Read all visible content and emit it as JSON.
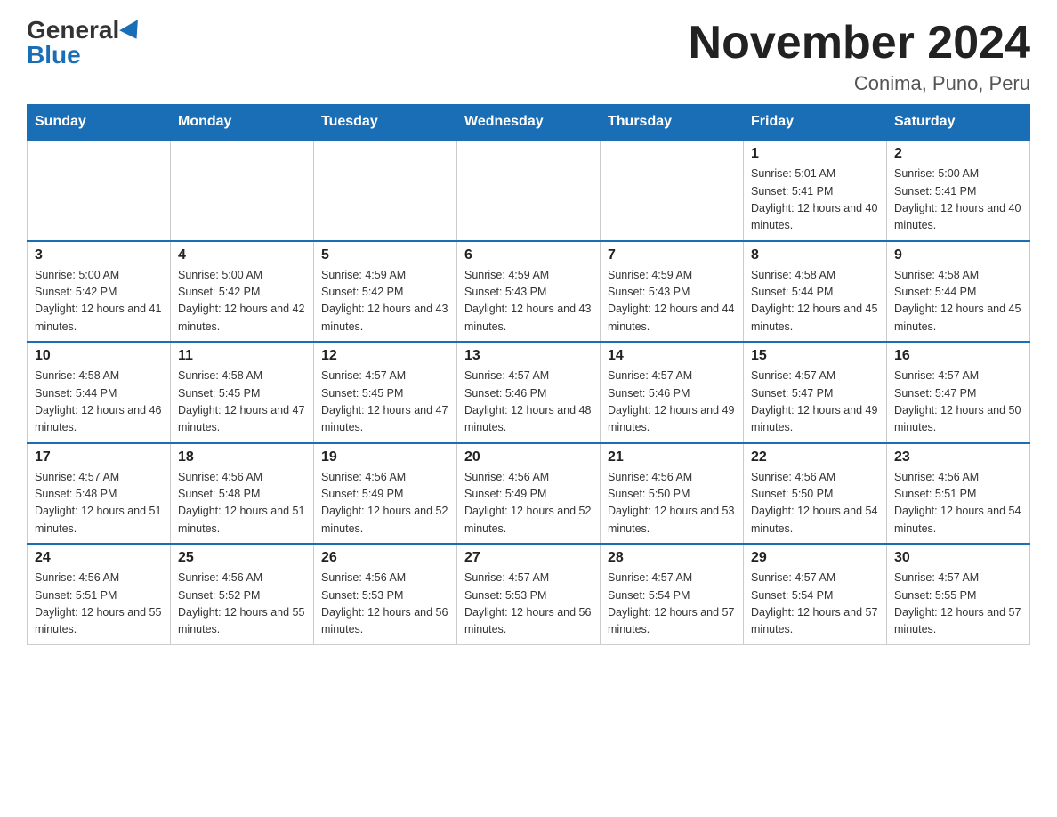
{
  "header": {
    "logo_general": "General",
    "logo_blue": "Blue",
    "month_title": "November 2024",
    "location": "Conima, Puno, Peru"
  },
  "days_of_week": [
    "Sunday",
    "Monday",
    "Tuesday",
    "Wednesday",
    "Thursday",
    "Friday",
    "Saturday"
  ],
  "weeks": [
    [
      {
        "day": "",
        "sunrise": "",
        "sunset": "",
        "daylight": ""
      },
      {
        "day": "",
        "sunrise": "",
        "sunset": "",
        "daylight": ""
      },
      {
        "day": "",
        "sunrise": "",
        "sunset": "",
        "daylight": ""
      },
      {
        "day": "",
        "sunrise": "",
        "sunset": "",
        "daylight": ""
      },
      {
        "day": "",
        "sunrise": "",
        "sunset": "",
        "daylight": ""
      },
      {
        "day": "1",
        "sunrise": "Sunrise: 5:01 AM",
        "sunset": "Sunset: 5:41 PM",
        "daylight": "Daylight: 12 hours and 40 minutes."
      },
      {
        "day": "2",
        "sunrise": "Sunrise: 5:00 AM",
        "sunset": "Sunset: 5:41 PM",
        "daylight": "Daylight: 12 hours and 40 minutes."
      }
    ],
    [
      {
        "day": "3",
        "sunrise": "Sunrise: 5:00 AM",
        "sunset": "Sunset: 5:42 PM",
        "daylight": "Daylight: 12 hours and 41 minutes."
      },
      {
        "day": "4",
        "sunrise": "Sunrise: 5:00 AM",
        "sunset": "Sunset: 5:42 PM",
        "daylight": "Daylight: 12 hours and 42 minutes."
      },
      {
        "day": "5",
        "sunrise": "Sunrise: 4:59 AM",
        "sunset": "Sunset: 5:42 PM",
        "daylight": "Daylight: 12 hours and 43 minutes."
      },
      {
        "day": "6",
        "sunrise": "Sunrise: 4:59 AM",
        "sunset": "Sunset: 5:43 PM",
        "daylight": "Daylight: 12 hours and 43 minutes."
      },
      {
        "day": "7",
        "sunrise": "Sunrise: 4:59 AM",
        "sunset": "Sunset: 5:43 PM",
        "daylight": "Daylight: 12 hours and 44 minutes."
      },
      {
        "day": "8",
        "sunrise": "Sunrise: 4:58 AM",
        "sunset": "Sunset: 5:44 PM",
        "daylight": "Daylight: 12 hours and 45 minutes."
      },
      {
        "day": "9",
        "sunrise": "Sunrise: 4:58 AM",
        "sunset": "Sunset: 5:44 PM",
        "daylight": "Daylight: 12 hours and 45 minutes."
      }
    ],
    [
      {
        "day": "10",
        "sunrise": "Sunrise: 4:58 AM",
        "sunset": "Sunset: 5:44 PM",
        "daylight": "Daylight: 12 hours and 46 minutes."
      },
      {
        "day": "11",
        "sunrise": "Sunrise: 4:58 AM",
        "sunset": "Sunset: 5:45 PM",
        "daylight": "Daylight: 12 hours and 47 minutes."
      },
      {
        "day": "12",
        "sunrise": "Sunrise: 4:57 AM",
        "sunset": "Sunset: 5:45 PM",
        "daylight": "Daylight: 12 hours and 47 minutes."
      },
      {
        "day": "13",
        "sunrise": "Sunrise: 4:57 AM",
        "sunset": "Sunset: 5:46 PM",
        "daylight": "Daylight: 12 hours and 48 minutes."
      },
      {
        "day": "14",
        "sunrise": "Sunrise: 4:57 AM",
        "sunset": "Sunset: 5:46 PM",
        "daylight": "Daylight: 12 hours and 49 minutes."
      },
      {
        "day": "15",
        "sunrise": "Sunrise: 4:57 AM",
        "sunset": "Sunset: 5:47 PM",
        "daylight": "Daylight: 12 hours and 49 minutes."
      },
      {
        "day": "16",
        "sunrise": "Sunrise: 4:57 AM",
        "sunset": "Sunset: 5:47 PM",
        "daylight": "Daylight: 12 hours and 50 minutes."
      }
    ],
    [
      {
        "day": "17",
        "sunrise": "Sunrise: 4:57 AM",
        "sunset": "Sunset: 5:48 PM",
        "daylight": "Daylight: 12 hours and 51 minutes."
      },
      {
        "day": "18",
        "sunrise": "Sunrise: 4:56 AM",
        "sunset": "Sunset: 5:48 PM",
        "daylight": "Daylight: 12 hours and 51 minutes."
      },
      {
        "day": "19",
        "sunrise": "Sunrise: 4:56 AM",
        "sunset": "Sunset: 5:49 PM",
        "daylight": "Daylight: 12 hours and 52 minutes."
      },
      {
        "day": "20",
        "sunrise": "Sunrise: 4:56 AM",
        "sunset": "Sunset: 5:49 PM",
        "daylight": "Daylight: 12 hours and 52 minutes."
      },
      {
        "day": "21",
        "sunrise": "Sunrise: 4:56 AM",
        "sunset": "Sunset: 5:50 PM",
        "daylight": "Daylight: 12 hours and 53 minutes."
      },
      {
        "day": "22",
        "sunrise": "Sunrise: 4:56 AM",
        "sunset": "Sunset: 5:50 PM",
        "daylight": "Daylight: 12 hours and 54 minutes."
      },
      {
        "day": "23",
        "sunrise": "Sunrise: 4:56 AM",
        "sunset": "Sunset: 5:51 PM",
        "daylight": "Daylight: 12 hours and 54 minutes."
      }
    ],
    [
      {
        "day": "24",
        "sunrise": "Sunrise: 4:56 AM",
        "sunset": "Sunset: 5:51 PM",
        "daylight": "Daylight: 12 hours and 55 minutes."
      },
      {
        "day": "25",
        "sunrise": "Sunrise: 4:56 AM",
        "sunset": "Sunset: 5:52 PM",
        "daylight": "Daylight: 12 hours and 55 minutes."
      },
      {
        "day": "26",
        "sunrise": "Sunrise: 4:56 AM",
        "sunset": "Sunset: 5:53 PM",
        "daylight": "Daylight: 12 hours and 56 minutes."
      },
      {
        "day": "27",
        "sunrise": "Sunrise: 4:57 AM",
        "sunset": "Sunset: 5:53 PM",
        "daylight": "Daylight: 12 hours and 56 minutes."
      },
      {
        "day": "28",
        "sunrise": "Sunrise: 4:57 AM",
        "sunset": "Sunset: 5:54 PM",
        "daylight": "Daylight: 12 hours and 57 minutes."
      },
      {
        "day": "29",
        "sunrise": "Sunrise: 4:57 AM",
        "sunset": "Sunset: 5:54 PM",
        "daylight": "Daylight: 12 hours and 57 minutes."
      },
      {
        "day": "30",
        "sunrise": "Sunrise: 4:57 AM",
        "sunset": "Sunset: 5:55 PM",
        "daylight": "Daylight: 12 hours and 57 minutes."
      }
    ]
  ]
}
